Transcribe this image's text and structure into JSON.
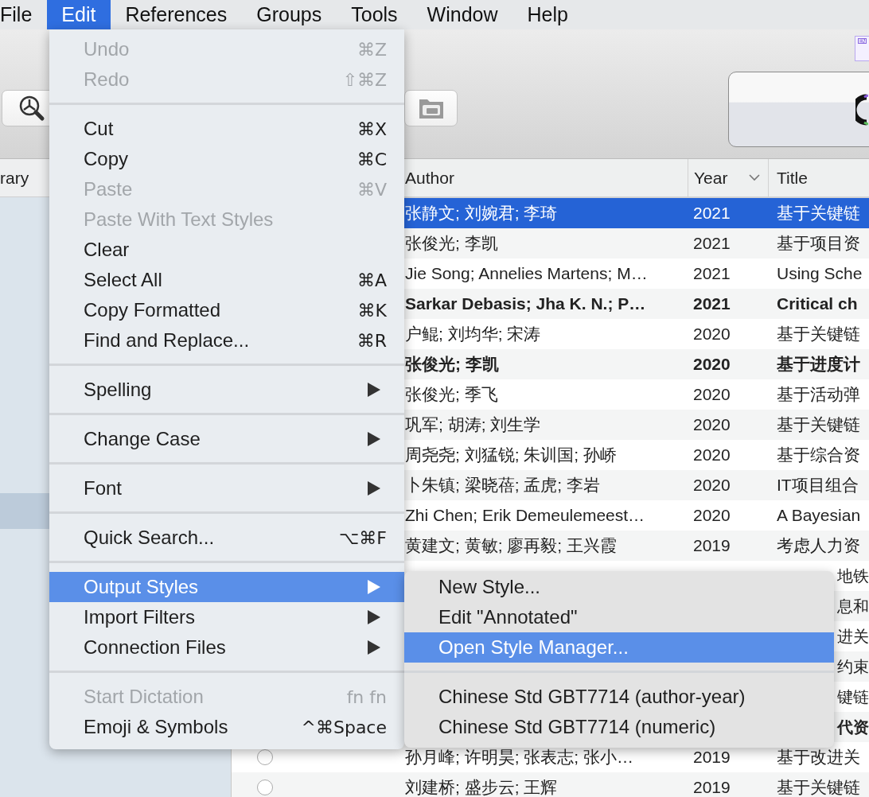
{
  "menu_bar": [
    {
      "label": "File",
      "selected": false
    },
    {
      "label": "Edit",
      "selected": true
    },
    {
      "label": "References",
      "selected": false
    },
    {
      "label": "Groups",
      "selected": false
    },
    {
      "label": "Tools",
      "selected": false
    },
    {
      "label": "Window",
      "selected": false
    },
    {
      "label": "Help",
      "selected": false
    }
  ],
  "toolbar": {
    "language_badge": "EN"
  },
  "sidebar": {
    "header": "rary"
  },
  "table": {
    "columns": [
      "Author",
      "Year",
      "Title"
    ],
    "rows": [
      {
        "author": "张静文; 刘婉君; 李琦",
        "year": "2021",
        "title": "基于关键链",
        "selected": true,
        "unread": false
      },
      {
        "author": "张俊光; 李凯",
        "year": "2021",
        "title": "基于项目资",
        "selected": false,
        "unread": false
      },
      {
        "author": "Jie Song; Annelies Martens; M…",
        "year": "2021",
        "title": "Using Sche",
        "selected": false,
        "unread": false
      },
      {
        "author": "Sarkar Debasis; Jha K. N.; P…",
        "year": "2021",
        "title": "Critical ch",
        "selected": false,
        "unread": true
      },
      {
        "author": "户鲲; 刘均华; 宋涛",
        "year": "2020",
        "title": "基于关键链",
        "selected": false,
        "unread": false
      },
      {
        "author": "张俊光; 李凯",
        "year": "2020",
        "title": "基于进度计",
        "selected": false,
        "unread": true
      },
      {
        "author": "张俊光; 季飞",
        "year": "2020",
        "title": "基于活动弹",
        "selected": false,
        "unread": false
      },
      {
        "author": "巩军; 胡涛; 刘生学",
        "year": "2020",
        "title": "基于关键链",
        "selected": false,
        "unread": false
      },
      {
        "author": "周尧尧; 刘猛锐; 朱训国; 孙峤",
        "year": "2020",
        "title": "基于综合资",
        "selected": false,
        "unread": false
      },
      {
        "author": "卜朱镇; 梁晓蓓; 孟虎; 李岩",
        "year": "2020",
        "title": "IT项目组合",
        "selected": false,
        "unread": false
      },
      {
        "author": "Zhi Chen; Erik Demeulemeest…",
        "year": "2020",
        "title": "A Bayesian",
        "selected": false,
        "unread": false
      },
      {
        "author": "黄建文; 黄敏; 廖再毅; 王兴霞",
        "year": "2019",
        "title": "考虑人力资",
        "selected": false,
        "unread": false
      },
      {
        "title": "地铁",
        "selected": false,
        "unread": false
      },
      {
        "title": "息和",
        "selected": false,
        "unread": false
      },
      {
        "title": "进关",
        "selected": false,
        "unread": false
      },
      {
        "title": "约束",
        "selected": false,
        "unread": false
      },
      {
        "title": "键链",
        "selected": false,
        "unread": false
      },
      {
        "title": "代资",
        "selected": false,
        "unread": true
      },
      {
        "author": "孙月峰; 许明昊; 张表志; 张小…",
        "year": "2019",
        "title": "基于改进关",
        "selected": false,
        "unread": false,
        "read_marker": true
      },
      {
        "author": "刘建桥; 盛步云; 王辉",
        "year": "2019",
        "title": "基于关键链",
        "selected": false,
        "unread": false,
        "read_marker": true
      }
    ]
  },
  "edit_menu": {
    "items": [
      {
        "kind": "item",
        "label": "Undo",
        "shortcut": "⌘Z",
        "disabled": true,
        "selected": false
      },
      {
        "kind": "item",
        "label": "Redo",
        "shortcut": "⇧⌘Z",
        "disabled": true,
        "selected": false
      },
      {
        "kind": "separator"
      },
      {
        "kind": "item",
        "label": "Cut",
        "shortcut": "⌘X",
        "disabled": false,
        "selected": false
      },
      {
        "kind": "item",
        "label": "Copy",
        "shortcut": "⌘C",
        "disabled": false,
        "selected": false
      },
      {
        "kind": "item",
        "label": "Paste",
        "shortcut": "⌘V",
        "disabled": true,
        "selected": false
      },
      {
        "kind": "item",
        "label": "Paste With Text Styles",
        "disabled": true,
        "selected": false
      },
      {
        "kind": "item",
        "label": "Clear",
        "disabled": false,
        "selected": false
      },
      {
        "kind": "item",
        "label": "Select All",
        "shortcut": "⌘A",
        "disabled": false,
        "selected": false
      },
      {
        "kind": "item",
        "label": "Copy Formatted",
        "shortcut": "⌘K",
        "disabled": false,
        "selected": false
      },
      {
        "kind": "item",
        "label": "Find and Replace...",
        "shortcut": "⌘R",
        "disabled": false,
        "selected": false
      },
      {
        "kind": "separator"
      },
      {
        "kind": "submenu",
        "label": "Spelling",
        "disabled": false,
        "selected": false
      },
      {
        "kind": "separator"
      },
      {
        "kind": "submenu",
        "label": "Change Case",
        "disabled": false,
        "selected": false
      },
      {
        "kind": "separator"
      },
      {
        "kind": "submenu",
        "label": "Font",
        "disabled": false,
        "selected": false
      },
      {
        "kind": "separator"
      },
      {
        "kind": "item",
        "label": "Quick Search...",
        "shortcut": "⌥⌘F",
        "disabled": false,
        "selected": false
      },
      {
        "kind": "separator"
      },
      {
        "kind": "submenu",
        "label": "Output Styles",
        "disabled": false,
        "selected": true
      },
      {
        "kind": "submenu",
        "label": "Import Filters",
        "disabled": false,
        "selected": false
      },
      {
        "kind": "submenu",
        "label": "Connection Files",
        "disabled": false,
        "selected": false
      },
      {
        "kind": "separator"
      },
      {
        "kind": "item",
        "label": "Start Dictation",
        "shortcut": "fn fn",
        "disabled": true,
        "selected": false
      },
      {
        "kind": "item",
        "label": "Emoji & Symbols",
        "shortcut": "^⌘Space",
        "disabled": false,
        "selected": false
      }
    ]
  },
  "output_styles_submenu": {
    "items": [
      {
        "kind": "item",
        "label": "New Style...",
        "disabled": false,
        "selected": false
      },
      {
        "kind": "item",
        "label": "Edit \"Annotated\"",
        "disabled": false,
        "selected": false
      },
      {
        "kind": "item",
        "label": "Open Style Manager...",
        "disabled": false,
        "selected": true
      },
      {
        "kind": "separator"
      },
      {
        "kind": "item",
        "label": "Chinese Std GBT7714 (author-year)",
        "disabled": false,
        "selected": false
      },
      {
        "kind": "item",
        "label": "Chinese Std GBT7714 (numeric)",
        "disabled": false,
        "selected": false
      }
    ]
  }
}
